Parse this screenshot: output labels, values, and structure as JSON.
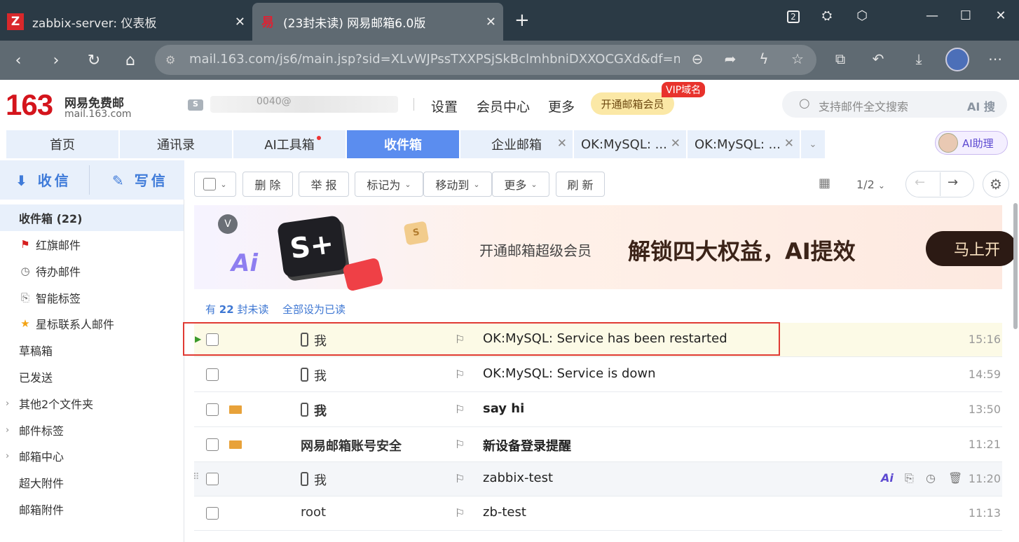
{
  "browser": {
    "tabs": [
      {
        "label": "zabbix-server: 仪表板",
        "favicon": "Z"
      },
      {
        "label": "(23封未读) 网易邮箱6.0版",
        "favicon": "易"
      }
    ],
    "url": "mail.163.com/js6/main.jsp?sid=XLvWJPssTXXPSjSkBclmhbniDXXOCGXd&df=m...",
    "tab_count": "2"
  },
  "header": {
    "logo_num": "163",
    "logo_cn": "网易免费邮",
    "logo_domain": "mail.163.com",
    "account_fragment": "0040@",
    "links": [
      "设置",
      "会员中心",
      "更多"
    ],
    "vip_button": "开通邮箱会员",
    "vip_tag": "VIP域名",
    "search_placeholder": "支持邮件全文搜索",
    "search_ai": "AI 搜"
  },
  "module_tabs": [
    "首页",
    "通讯录",
    "AI工具箱",
    "收件箱",
    "企业邮箱",
    "OK:MySQL: ...",
    "OK:MySQL: ..."
  ],
  "ai_helper": "AI助理",
  "sidebar": {
    "receive": "收信",
    "write": "写信",
    "items": [
      "收件箱 (22)",
      "红旗邮件",
      "待办邮件",
      "智能标签",
      "星标联系人邮件",
      "草稿箱",
      "已发送",
      "其他2个文件夹",
      "邮件标签",
      "邮箱中心",
      "超大附件",
      "邮箱附件"
    ]
  },
  "toolbar": {
    "delete": "删 除",
    "report": "举 报",
    "mark": "标记为",
    "move": "移动到",
    "more": "更多",
    "refresh": "刷 新",
    "page": "1/2"
  },
  "banner": {
    "line1": "开通邮箱超级会员",
    "line2": "解锁四大权益，AI提效",
    "button": "马上开",
    "badge": "S+",
    "ai": "Ai"
  },
  "unread": {
    "prefix": "有",
    "count": "22",
    "suffix": "封未读",
    "mark_all": "全部设为已读"
  },
  "mails": [
    {
      "sender": "我",
      "subject": "OK:MySQL: Service has been restarted",
      "time": "15:16"
    },
    {
      "sender": "我",
      "subject": "OK:MySQL: Service is down",
      "time": "14:59"
    },
    {
      "sender": "我",
      "subject": "say hi",
      "time": "13:50"
    },
    {
      "sender": "网易邮箱账号安全",
      "subject": "新设备登录提醒",
      "time": "11:21"
    },
    {
      "sender": "我",
      "subject": "zabbix-test",
      "time": "11:20"
    },
    {
      "sender": "root",
      "subject": "zb-test",
      "time": "11:13"
    }
  ],
  "colors": {
    "accent": "#5b8def",
    "highlight_box": "#e03a34",
    "brand": "#d4141c"
  }
}
